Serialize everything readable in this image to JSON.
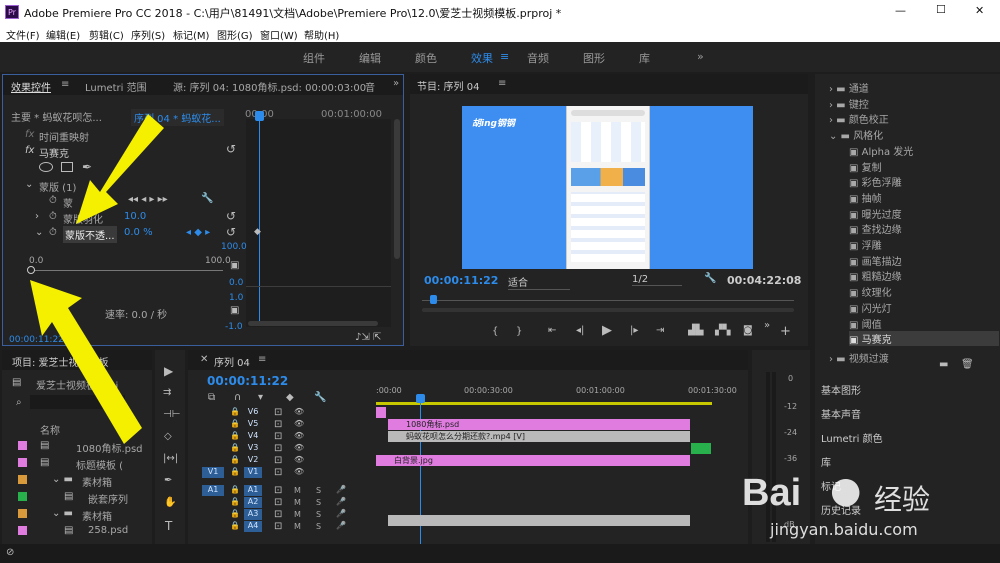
{
  "window": {
    "title": "Adobe Premiere Pro CC 2018 - C:\\用户\\81491\\文档\\Adobe\\Premiere Pro\\12.0\\爱芝士视频模板.prproj *",
    "min": "—",
    "max": "☐",
    "close": "✕"
  },
  "menu": [
    "文件(F)",
    "编辑(E)",
    "剪辑(C)",
    "序列(S)",
    "标记(M)",
    "图形(G)",
    "窗口(W)",
    "帮助(H)"
  ],
  "workspaces": [
    "组件",
    "编辑",
    "颜色",
    "效果",
    "音频",
    "图形",
    "库"
  ],
  "workspace_active": "效果",
  "ws_more": "»",
  "effects_panel": {
    "tabs": [
      "效果控件",
      "Lumetri 范围",
      "源: 序列 04: 1080角标.psd: 00:00:03:00",
      "音"
    ],
    "more": "»",
    "master": "主要 * 蚂蚁花呗怎...",
    "seq": "序列 04 * 蚂蚁花...",
    "time_a": "00:00",
    "time_b": "00:01:00:00",
    "rows": {
      "timeremap": "时间重映射",
      "mosaic": "马赛克",
      "mask": "蒙版 (1)",
      "mask_abbr": "蒙",
      "feather": "蒙版羽化",
      "feather_val": "10.0",
      "opacity": "蒙版不透...",
      "opacity_val": "0.0 %",
      "scale_max": "100.0",
      "slider_min": "0.0",
      "slider_max": "100.0",
      "g0": "0.0",
      "g1": "1.0",
      "g2": "-1.0",
      "val100": "100.0",
      "speed": "速率: 0.0 / 秒"
    },
    "timecode": "00:00:11:22",
    "fx": "fx"
  },
  "program": {
    "title": "节目: 序列 04",
    "timecode": "00:00:11:22",
    "fit": "适合",
    "res": "1/2",
    "duration": "00:04:22:08",
    "logo": "胡ing钢钢",
    "menu_icon": "≡"
  },
  "fx_tree": {
    "items": [
      "通道",
      "键控",
      "颜色校正",
      "风格化",
      "Alpha 发光",
      "复制",
      "彩色浮雕",
      "抽帧",
      "曝光过度",
      "查找边缘",
      "浮雕",
      "画笔描边",
      "粗糙边缘",
      "纹理化",
      "闪光灯",
      "阈值",
      "马赛克",
      "视频过渡"
    ],
    "panels": [
      "基本图形",
      "基本声音",
      "Lumetri 颜色",
      "库",
      "标记",
      "历史记录"
    ]
  },
  "project": {
    "title": "项目: 爱芝士视频模板",
    "file": "爱芝士视频板...roj",
    "name_col": "名称",
    "items": [
      "1080角标.psd",
      "标题模板 (",
      "素材箱",
      "嵌套序列",
      "素材箱",
      "258.psd"
    ]
  },
  "timeline": {
    "tab": "序列 04",
    "timecode": "00:00:11:22",
    "ruler": [
      ":00:00",
      "00:00:30:00",
      "00:01:00:00",
      "00:01:30:00"
    ],
    "tracks": [
      "V6",
      "V5",
      "V4",
      "V3",
      "V2",
      "V1",
      "A1",
      "A2",
      "A3",
      "A4"
    ],
    "clips": {
      "c1": "1080角标.psd",
      "c2": "蚂蚁花呗怎么分期还款?.mp4 [V]",
      "c3": "白背景.jpg"
    },
    "m": "M",
    "s": "S"
  },
  "meter": {
    "labels": [
      "0",
      "-12",
      "-24",
      "-36",
      "dB"
    ]
  },
  "watermark": {
    "brand": "Bai",
    "brand2": "经验",
    "url": "jingyan.baidu.com"
  },
  "colors": {
    "accent": "#2d8ceb",
    "arrow": "#f4f000",
    "clip_pink": "#e07ce0",
    "clip_gray": "#b9b9b9"
  }
}
